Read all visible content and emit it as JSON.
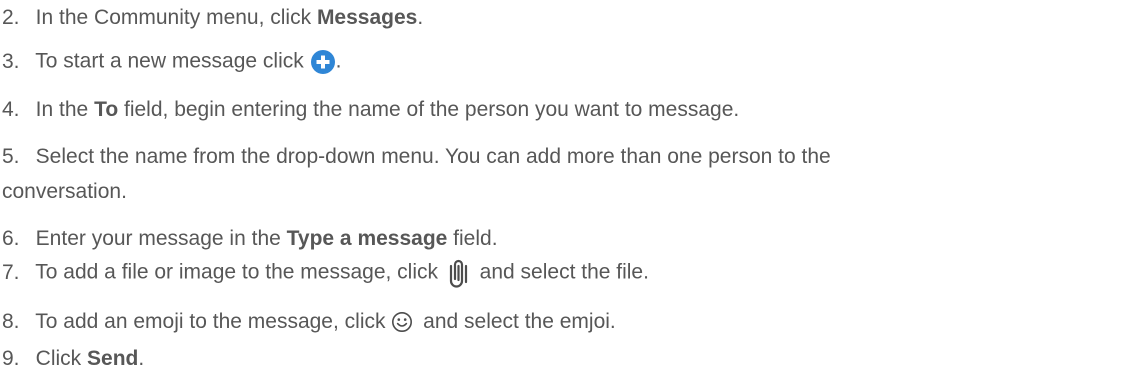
{
  "steps": [
    {
      "num": "2.",
      "before": "In the Community menu, click ",
      "bold": "Messages",
      "after": "."
    },
    {
      "num": "3.",
      "before": "To start a new message click ",
      "icon": "plus-circle-icon",
      "after": "."
    },
    {
      "num": "4.",
      "before": "In the ",
      "bold": "To",
      "after": " field, begin entering the name of the person you want to message."
    },
    {
      "num": "5.",
      "line1": "Select the name from the drop-down menu. You can add more than one person to the",
      "line2": "conversation."
    },
    {
      "num": "6.",
      "before": "Enter your message in the ",
      "bold": "Type a message",
      "after": " field."
    },
    {
      "num": "7.",
      "before": "To add a file or image to the message, click ",
      "icon": "paperclip-icon",
      "after": " and select the file."
    },
    {
      "num": "8.",
      "before": "To add an emoji to the message, click ",
      "icon": "smiley-icon",
      "after": " and select the emjoi."
    },
    {
      "num": "9.",
      "before": "Click ",
      "bold": "Send",
      "after": "."
    }
  ],
  "colors": {
    "text": "#575757",
    "plus_icon": "#2f86d6"
  }
}
